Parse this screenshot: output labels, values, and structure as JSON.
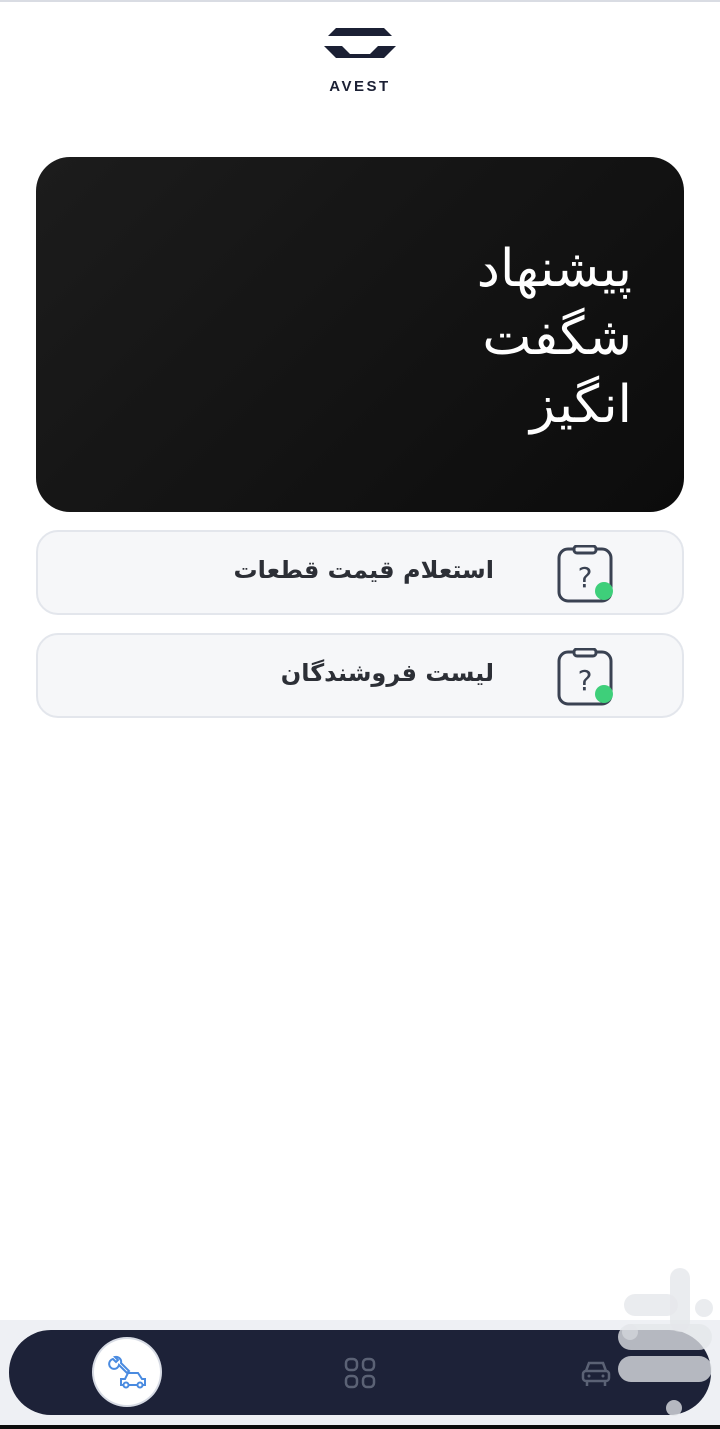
{
  "header": {
    "brand": "AVEST"
  },
  "hero": {
    "lines": [
      "پیشنهاد",
      "شگفت",
      "انگیز"
    ]
  },
  "menu": {
    "items": [
      {
        "label": "استعلام قیمت قطعات",
        "icon": "clipboard-question-icon"
      },
      {
        "label": "لیست فروشندگان",
        "icon": "clipboard-question-icon"
      }
    ]
  },
  "nav": {
    "items": [
      {
        "icon": "car-repair-icon",
        "active": true
      },
      {
        "icon": "grid-icon",
        "active": false
      },
      {
        "icon": "car-icon",
        "active": false
      }
    ]
  },
  "colors": {
    "nav_bg": "#1d2238",
    "status_dot": "#3ecf7a",
    "icon_stroke": "#3a4252",
    "active_icon": "#4a8be0"
  }
}
